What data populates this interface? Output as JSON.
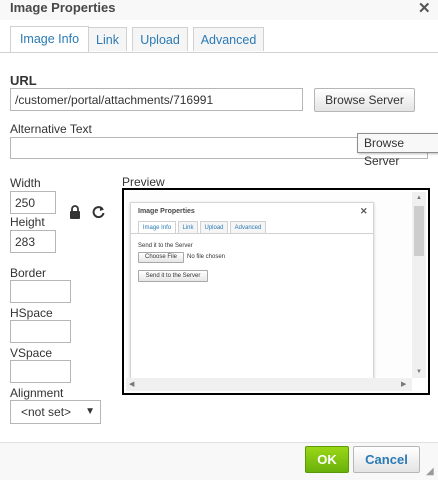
{
  "dialog": {
    "title": "Image Properties"
  },
  "tabs": [
    {
      "label": "Image Info",
      "active": true
    },
    {
      "label": "Link"
    },
    {
      "label": "Upload"
    },
    {
      "label": "Advanced"
    }
  ],
  "url": {
    "label": "URL",
    "value": "/customer/portal/attachments/716991",
    "browse_label": "Browse Server",
    "tooltip": "Browse Server"
  },
  "alt": {
    "label": "Alternative Text",
    "value": ""
  },
  "width": {
    "label": "Width",
    "value": "250"
  },
  "height": {
    "label": "Height",
    "value": "283"
  },
  "border": {
    "label": "Border",
    "value": ""
  },
  "hspace": {
    "label": "HSpace",
    "value": ""
  },
  "vspace": {
    "label": "VSpace",
    "value": ""
  },
  "alignment": {
    "label": "Alignment",
    "value": "<not set>"
  },
  "preview": {
    "label": "Preview",
    "mini_dialog": {
      "title": "Image Properties",
      "tabs": [
        "Image Info",
        "Link",
        "Upload",
        "Advanced"
      ],
      "send_label": "Send it to the Server",
      "choose_file": "Choose File",
      "no_file": "No file chosen",
      "send_button": "Send it to the Server"
    }
  },
  "footer": {
    "ok": "OK",
    "cancel": "Cancel"
  },
  "colors": {
    "accent": "#2a7ab4",
    "ok_green": "#7ac014"
  },
  "icons": {
    "close": "close-icon",
    "lock": "lock-icon",
    "reset": "reset-icon"
  }
}
